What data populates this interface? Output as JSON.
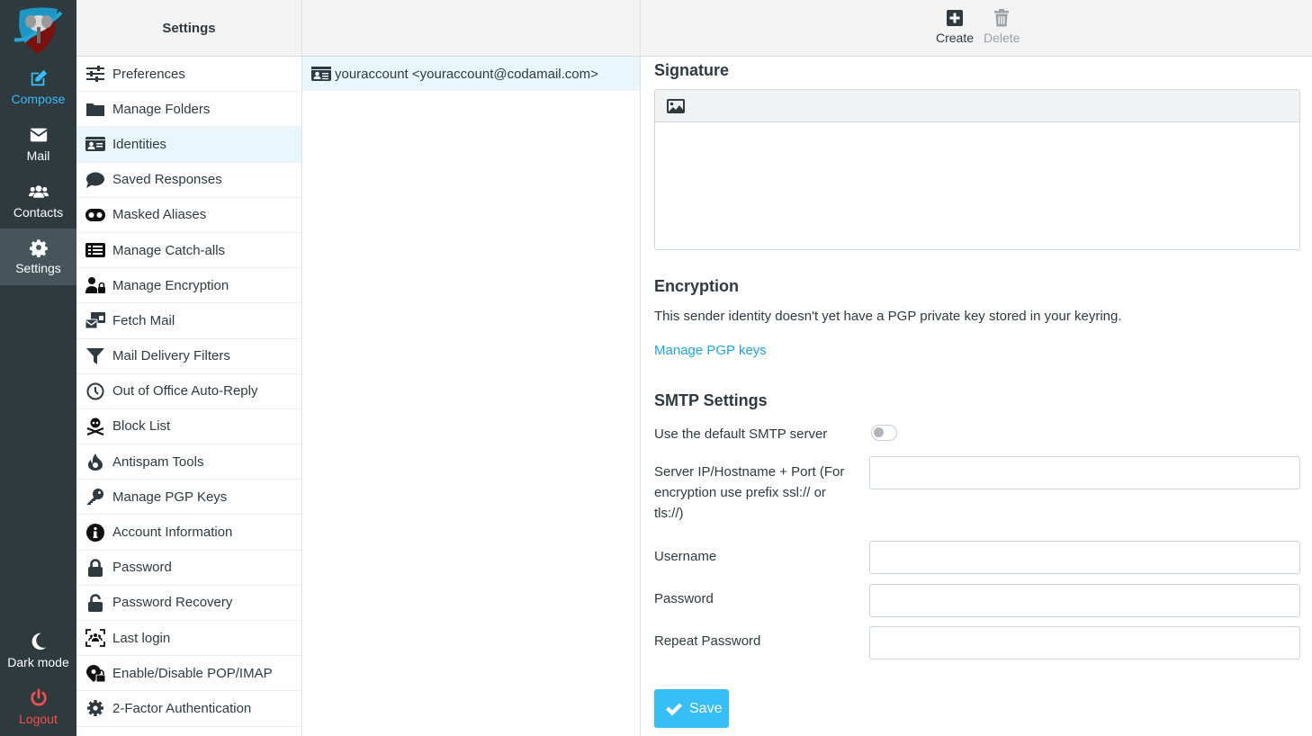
{
  "nav": {
    "items": [
      {
        "id": "compose",
        "label": "Compose",
        "icon": "compose-icon"
      },
      {
        "id": "mail",
        "label": "Mail",
        "icon": "envelope-icon"
      },
      {
        "id": "contacts",
        "label": "Contacts",
        "icon": "users-icon"
      },
      {
        "id": "settings",
        "label": "Settings",
        "icon": "gear-icon",
        "active": true
      }
    ],
    "dark_mode_label": "Dark mode",
    "logout_label": "Logout",
    "accent_color": "#37bdf4",
    "logout_color": "#f0504d"
  },
  "settings_menu": {
    "title": "Settings",
    "items": [
      {
        "label": "Preferences",
        "icon": "sliders-icon"
      },
      {
        "label": "Manage Folders",
        "icon": "folder-icon"
      },
      {
        "label": "Identities",
        "icon": "id-card-icon",
        "active": true
      },
      {
        "label": "Saved Responses",
        "icon": "comment-icon"
      },
      {
        "label": "Masked Aliases",
        "icon": "mask-icon"
      },
      {
        "label": "Manage Catch-alls",
        "icon": "list-icon"
      },
      {
        "label": "Manage Encryption",
        "icon": "user-lock-icon"
      },
      {
        "label": "Fetch Mail",
        "icon": "mail-bulk-icon"
      },
      {
        "label": "Mail Delivery Filters",
        "icon": "filter-icon"
      },
      {
        "label": "Out of Office Auto-Reply",
        "icon": "clock-icon"
      },
      {
        "label": "Block List",
        "icon": "skull-crossbones-icon"
      },
      {
        "label": "Antispam Tools",
        "icon": "fire-icon"
      },
      {
        "label": "Manage PGP Keys",
        "icon": "key-icon"
      },
      {
        "label": "Account Information",
        "icon": "info-circle-icon"
      },
      {
        "label": "Password",
        "icon": "lock-icon"
      },
      {
        "label": "Password Recovery",
        "icon": "lock-open-icon"
      },
      {
        "label": "Last login",
        "icon": "users-viewfinder-icon"
      },
      {
        "label": "Enable/Disable POP/IMAP",
        "icon": "location-lock-icon"
      },
      {
        "label": "2-Factor Authentication",
        "icon": "gear-icon"
      }
    ]
  },
  "identities": {
    "items": [
      {
        "label": "youraccount <youraccount@codamail.com>",
        "selected": true
      }
    ]
  },
  "toolbar": {
    "create_label": "Create",
    "delete_label": "Delete"
  },
  "identity_form": {
    "signature": {
      "title": "Signature",
      "insert_image_icon": "image-icon",
      "value": ""
    },
    "encryption": {
      "title": "Encryption",
      "text": "This sender identity doesn't yet have a PGP private key stored in your keyring.",
      "link_label": "Manage PGP keys",
      "link_color": "#1ba6e8"
    },
    "smtp": {
      "title": "SMTP Settings",
      "use_default_label": "Use the default SMTP server",
      "use_default_on": false,
      "server_label": "Server IP/Hostname + Port (For encryption use prefix ssl:// or tls://)",
      "server_value": "",
      "username_label": "Username",
      "username_value": "",
      "password_label": "Password",
      "password_value": "",
      "repeat_password_label": "Repeat Password",
      "repeat_password_value": ""
    },
    "save_label": "Save",
    "save_color": "#36bef6"
  }
}
